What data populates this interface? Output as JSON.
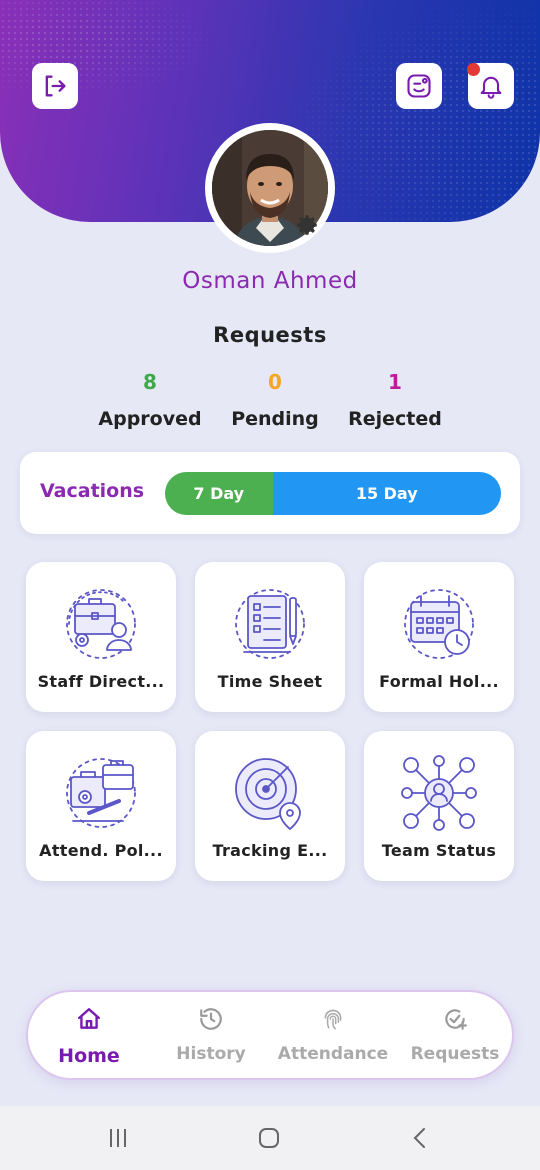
{
  "header": {
    "logout_icon": "logout-icon",
    "chat_icon": "chat-bot-icon",
    "notification_icon": "bell-icon",
    "has_notification": true,
    "colors": {
      "start": "#8a2fb8",
      "end": "#0d33a8"
    }
  },
  "profile": {
    "name": "Osman Ahmed",
    "avatar_icon": "avatar-photo",
    "settings_icon": "gear-icon"
  },
  "requests": {
    "title": "Requests",
    "stats": [
      {
        "count": "8",
        "label": "Approved",
        "color": "#3fa84a"
      },
      {
        "count": "0",
        "label": "Pending",
        "color": "#f5a623"
      },
      {
        "count": "1",
        "label": "Rejected",
        "color": "#c2189c"
      }
    ]
  },
  "vacations": {
    "label": "Vacations",
    "segments": [
      {
        "label": "7 Day",
        "color": "#4caf50",
        "share": 0.32
      },
      {
        "label": "15 Day",
        "color": "#2196f3",
        "share": 0.68
      }
    ]
  },
  "tiles": [
    {
      "label": "Staff Direct...",
      "icon": "staff-directory-icon"
    },
    {
      "label": "Time Sheet",
      "icon": "time-sheet-icon"
    },
    {
      "label": "Formal Hol...",
      "icon": "formal-holiday-calendar-icon"
    },
    {
      "label": "Attend. Pol...",
      "icon": "attendance-policy-icon"
    },
    {
      "label": "Tracking E...",
      "icon": "tracking-radar-icon"
    },
    {
      "label": "Team Status",
      "icon": "team-status-icon"
    }
  ],
  "bottom_nav": [
    {
      "label": "Home",
      "icon": "home-icon",
      "active": true
    },
    {
      "label": "History",
      "icon": "history-icon",
      "active": false
    },
    {
      "label": "Attendance",
      "icon": "fingerprint-icon",
      "active": false
    },
    {
      "label": "Requests",
      "icon": "check-add-icon",
      "active": false
    }
  ],
  "system_nav": {
    "recent_icon": "recent-apps-icon",
    "home_icon": "system-home-icon",
    "back_icon": "back-icon"
  }
}
